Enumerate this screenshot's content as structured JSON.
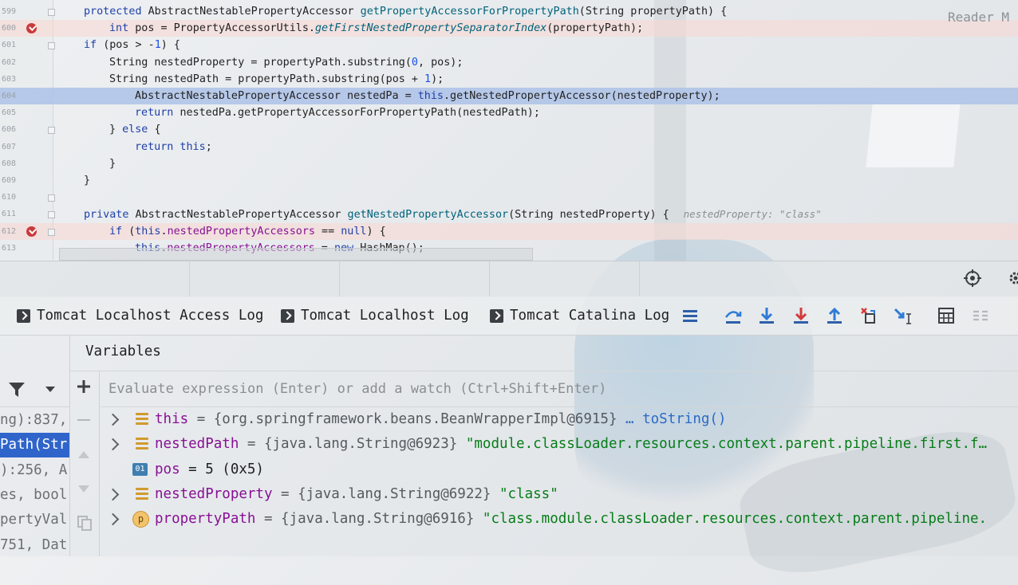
{
  "editor": {
    "reader_mode_label": "Reader M",
    "lines": [
      {
        "num": "599",
        "segments": [
          [
            "kw",
            "protected "
          ],
          [
            "",
            "AbstractNestablePropertyAccessor "
          ],
          [
            "fn",
            "getPropertyAccessorForPropertyPath"
          ],
          [
            "",
            "(String propertyPath) {"
          ]
        ]
      },
      {
        "num": "600",
        "segments": [
          [
            "",
            "    "
          ],
          [
            "kw",
            "int "
          ],
          [
            "",
            "pos = PropertyAccessorUtils."
          ],
          [
            "it fn",
            "getFirstNestedPropertySeparatorIndex"
          ],
          [
            "",
            "(propertyPath);"
          ]
        ]
      },
      {
        "num": "601",
        "segments": [
          [
            "",
            "    "
          ],
          [
            "kw",
            "if "
          ],
          [
            "",
            "(pos > -"
          ],
          [
            "num",
            "1"
          ],
          [
            "",
            ") {"
          ]
        ]
      },
      {
        "num": "602",
        "segments": [
          [
            "",
            "        String nestedProperty = propertyPath.substring("
          ],
          [
            "num",
            "0"
          ],
          [
            "",
            ", pos);"
          ]
        ]
      },
      {
        "num": "603",
        "segments": [
          [
            "",
            "        String nestedPath = propertyPath.substring(pos + "
          ],
          [
            "num",
            "1"
          ],
          [
            "",
            ");"
          ]
        ]
      },
      {
        "num": "604",
        "segments": [
          [
            "",
            "        AbstractNestablePropertyAccessor nestedPa = "
          ],
          [
            "kw",
            "this"
          ],
          [
            "",
            ".getNestedPropertyAccessor(nestedProperty);"
          ]
        ]
      },
      {
        "num": "605",
        "segments": [
          [
            "",
            "        "
          ],
          [
            "kw",
            "return "
          ],
          [
            "",
            "nestedPa.getPropertyAccessorForPropertyPath(nestedPath);"
          ]
        ]
      },
      {
        "num": "606",
        "segments": [
          [
            "",
            "    } "
          ],
          [
            "kw",
            "else "
          ],
          [
            "",
            "{"
          ]
        ]
      },
      {
        "num": "607",
        "segments": [
          [
            "",
            "        "
          ],
          [
            "kw",
            "return this"
          ],
          [
            "",
            ";"
          ]
        ]
      },
      {
        "num": "608",
        "segments": [
          [
            "",
            "    }"
          ]
        ]
      },
      {
        "num": "609",
        "segments": [
          [
            "",
            "}"
          ]
        ]
      },
      {
        "num": "610",
        "segments": []
      },
      {
        "num": "611",
        "segments": [
          [
            "kw",
            "private "
          ],
          [
            "",
            "AbstractNestablePropertyAccessor "
          ],
          [
            "fn",
            "getNestedPropertyAccessor"
          ],
          [
            "",
            "(String nestedProperty) {"
          ]
        ],
        "hint": "nestedProperty: \"class\""
      },
      {
        "num": "612",
        "segments": [
          [
            "",
            "    "
          ],
          [
            "kw",
            "if "
          ],
          [
            "",
            "("
          ],
          [
            "kw",
            "this"
          ],
          [
            "",
            "."
          ],
          [
            "fld",
            "nestedPropertyAccessors"
          ],
          [
            "",
            " == "
          ],
          [
            "kw",
            "null"
          ],
          [
            "",
            ") {"
          ]
        ]
      },
      {
        "num": "613",
        "segments": [
          [
            "",
            "        "
          ],
          [
            "kw",
            "this"
          ],
          [
            "",
            "."
          ],
          [
            "fld",
            "nestedPropertyAccessors"
          ],
          [
            "",
            " = "
          ],
          [
            "kw",
            "new "
          ],
          [
            "",
            "HashMap();"
          ]
        ]
      }
    ]
  },
  "tabs": [
    {
      "label": "Tomcat Localhost Access Log"
    },
    {
      "label": "Tomcat Localhost Log"
    },
    {
      "label": "Tomcat Catalina Log"
    }
  ],
  "debugger": {
    "variables_title": "Variables",
    "eval_placeholder": "Evaluate expression (Enter) or add a watch (Ctrl+Shift+Enter)",
    "frames": [
      "ng):837, ",
      "Path(Str",
      "):256, A",
      "es, bool",
      "pertyVal",
      "751, Dat"
    ],
    "variables": [
      {
        "name": "this",
        "rest_type": " = {org.springframework.beans.BeanWrapperImpl@6915} ",
        "rest_value": "… toString()",
        "value_kind": "link",
        "icon": "field-icon",
        "expandable": true
      },
      {
        "name": "nestedPath",
        "rest_type": " = {java.lang.String@6923} ",
        "rest_value": "\"module.classLoader.resources.context.parent.pipeline.first.f…",
        "value_kind": "string",
        "icon": "field-icon",
        "expandable": true
      },
      {
        "name": "pos",
        "rest_type": "",
        "rest_value": " = 5 (0x5)",
        "value_kind": "plain",
        "icon": "int-icon",
        "expandable": false
      },
      {
        "name": "nestedProperty",
        "rest_type": " = {java.lang.String@6922} ",
        "rest_value": "\"class\"",
        "value_kind": "string",
        "icon": "field-icon",
        "expandable": true
      },
      {
        "name": "propertyPath",
        "rest_type": " = {java.lang.String@6916} ",
        "rest_value": "\"class.module.classLoader.resources.context.parent.pipeline.",
        "value_kind": "string",
        "icon": "param-icon",
        "expandable": true
      }
    ]
  },
  "colors": {
    "breakpoint": "#c93a3a",
    "current_line": "#b0c4e8",
    "selected_frame": "#2f65ca"
  }
}
